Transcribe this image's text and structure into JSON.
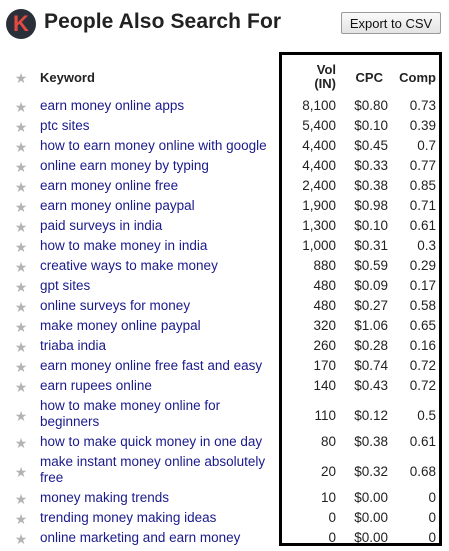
{
  "header": {
    "logo_letter": "K",
    "title": "People Also Search For",
    "export_label": "Export to CSV"
  },
  "columns": {
    "keyword": "Keyword",
    "vol_line1": "Vol",
    "vol_line2": "(IN)",
    "cpc": "CPC",
    "comp": "Comp"
  },
  "rows": [
    {
      "keyword": "earn money online apps",
      "vol": "8,100",
      "cpc": "$0.80",
      "comp": "0.73"
    },
    {
      "keyword": "ptc sites",
      "vol": "5,400",
      "cpc": "$0.10",
      "comp": "0.39"
    },
    {
      "keyword": "how to earn money online with google",
      "vol": "4,400",
      "cpc": "$0.45",
      "comp": "0.7"
    },
    {
      "keyword": "online earn money by typing",
      "vol": "4,400",
      "cpc": "$0.33",
      "comp": "0.77"
    },
    {
      "keyword": "earn money online free",
      "vol": "2,400",
      "cpc": "$0.38",
      "comp": "0.85"
    },
    {
      "keyword": "earn money online paypal",
      "vol": "1,900",
      "cpc": "$0.98",
      "comp": "0.71"
    },
    {
      "keyword": "paid surveys in india",
      "vol": "1,300",
      "cpc": "$0.10",
      "comp": "0.61"
    },
    {
      "keyword": "how to make money in india",
      "vol": "1,000",
      "cpc": "$0.31",
      "comp": "0.3"
    },
    {
      "keyword": "creative ways to make money",
      "vol": "880",
      "cpc": "$0.59",
      "comp": "0.29"
    },
    {
      "keyword": "gpt sites",
      "vol": "480",
      "cpc": "$0.09",
      "comp": "0.17"
    },
    {
      "keyword": "online surveys for money",
      "vol": "480",
      "cpc": "$0.27",
      "comp": "0.58"
    },
    {
      "keyword": "make money online paypal",
      "vol": "320",
      "cpc": "$1.06",
      "comp": "0.65"
    },
    {
      "keyword": "triaba india",
      "vol": "260",
      "cpc": "$0.28",
      "comp": "0.16"
    },
    {
      "keyword": "earn money online free fast and easy",
      "vol": "170",
      "cpc": "$0.74",
      "comp": "0.72"
    },
    {
      "keyword": "earn rupees online",
      "vol": "140",
      "cpc": "$0.43",
      "comp": "0.72"
    },
    {
      "keyword": "how to make money online for beginners",
      "vol": "110",
      "cpc": "$0.12",
      "comp": "0.5"
    },
    {
      "keyword": "how to make quick money in one day",
      "vol": "80",
      "cpc": "$0.38",
      "comp": "0.61"
    },
    {
      "keyword": "make instant money online absolutely free",
      "vol": "20",
      "cpc": "$0.32",
      "comp": "0.68"
    },
    {
      "keyword": "money making trends",
      "vol": "10",
      "cpc": "$0.00",
      "comp": "0"
    },
    {
      "keyword": "trending money making ideas",
      "vol": "0",
      "cpc": "$0.00",
      "comp": "0"
    },
    {
      "keyword": "online marketing and earn money",
      "vol": "0",
      "cpc": "$0.00",
      "comp": "0"
    }
  ]
}
